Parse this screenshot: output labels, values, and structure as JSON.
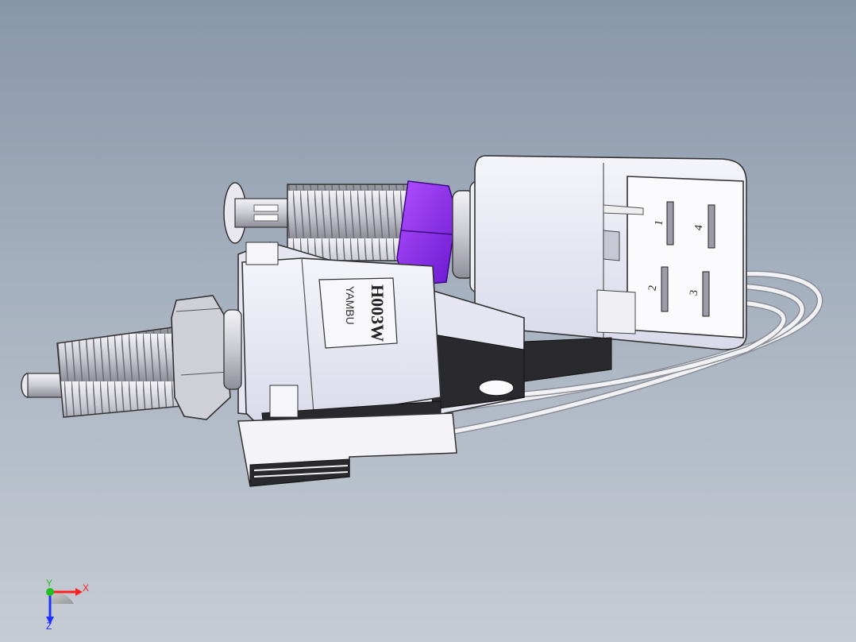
{
  "model": {
    "brand_mark": "YAMBU",
    "part_number": "H003W",
    "pin_labels": [
      "1",
      "4",
      "2",
      "3"
    ]
  },
  "triad": {
    "x_label": "X",
    "y_label": "Y",
    "z_label": "Z",
    "x_color": "#ff2020",
    "y_color": "#20c020",
    "z_color": "#2030ff"
  },
  "colors": {
    "nut": "#8a2cf0",
    "body": "#e6e6f2",
    "housing": "#f4f4f8",
    "dark": "#2a2a2e"
  }
}
